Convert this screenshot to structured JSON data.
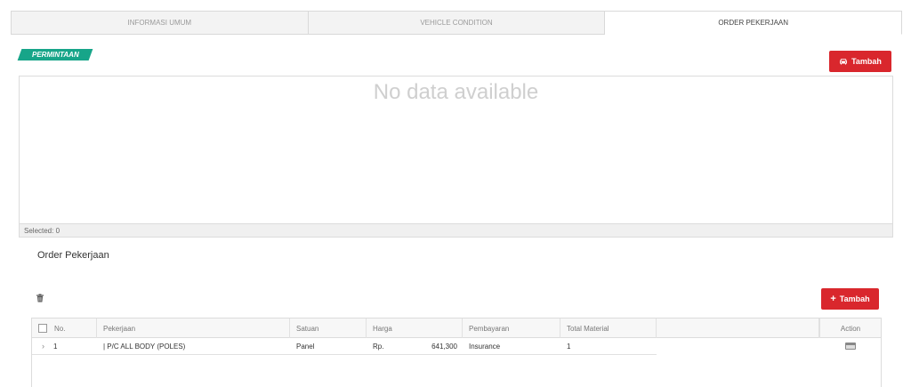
{
  "tabs": [
    {
      "label": "INFORMASI UMUM",
      "active": false
    },
    {
      "label": "VEHICLE CONDITION",
      "active": false
    },
    {
      "label": "ORDER PEKERJAAN",
      "active": true
    }
  ],
  "permintaan": {
    "label": "PERMINTAAN",
    "add_button": {
      "label": "Tambah",
      "icon": "car-icon"
    },
    "empty_text": "No data available",
    "footer_text": "Selected: 0"
  },
  "order": {
    "title": "Order Pekerjaan",
    "delete_icon": "trash-icon",
    "add_button": {
      "label": "Tambah",
      "icon": "plus-icon"
    },
    "columns": {
      "no": "No.",
      "pekerjaan": "Pekerjaan",
      "satuan": "Satuan",
      "harga": "Harga",
      "pembayaran": "Pembayaran",
      "total_material": "Total Material",
      "action": "Action"
    },
    "rows": [
      {
        "no": "1",
        "pekerjaan": "| P/C ALL BODY (POLES)",
        "satuan": "Panel",
        "currency": "Rp.",
        "harga": "641,300",
        "pembayaran": "Insurance",
        "total_material": "1",
        "action_icon": "calculator-icon"
      }
    ]
  },
  "colors": {
    "accent_red": "#d9272d",
    "label_green": "#17a589"
  }
}
